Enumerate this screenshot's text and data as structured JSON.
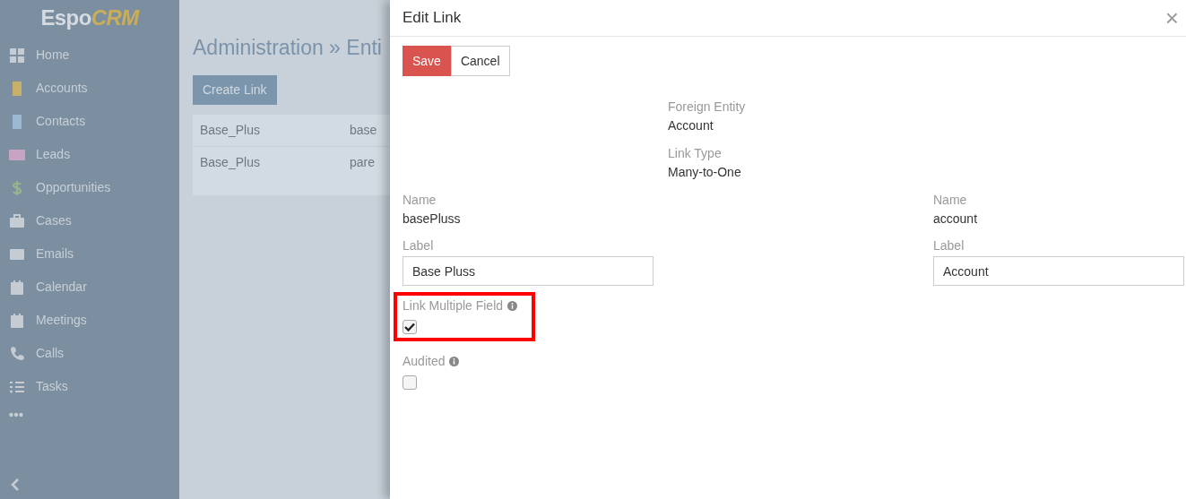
{
  "logo": {
    "part_1": "Espo",
    "part_2": "CRM"
  },
  "sidebar": {
    "items": [
      {
        "label": "Home"
      },
      {
        "label": "Accounts"
      },
      {
        "label": "Contacts"
      },
      {
        "label": "Leads"
      },
      {
        "label": "Opportunities"
      },
      {
        "label": "Cases"
      },
      {
        "label": "Emails"
      },
      {
        "label": "Calendar"
      },
      {
        "label": "Meetings"
      },
      {
        "label": "Calls"
      },
      {
        "label": "Tasks"
      }
    ]
  },
  "page": {
    "title": "Administration » Enti",
    "button": "Create Link",
    "rows": [
      [
        "Base_Plus",
        "base"
      ],
      [
        "Base_Plus",
        "pare"
      ]
    ]
  },
  "modal": {
    "title": "Edit Link",
    "close": "×",
    "buttons": [
      {
        "label": "Save",
        "kind": "primary"
      },
      {
        "label": "Cancel",
        "kind": "default"
      }
    ],
    "middle": [
      {
        "label": "Foreign Entity",
        "value": "Account"
      },
      {
        "label": "Link Type",
        "value": "Many-to-One"
      }
    ],
    "left": {
      "name_label": "Name",
      "name": "basePluss",
      "label_label": "Label",
      "label_value": "Base Pluss"
    },
    "right": {
      "name_label": "Name",
      "name": "account",
      "label_label": "Label",
      "label_value": "Account"
    },
    "checkboxes": [
      {
        "label": "Link Multiple Field",
        "checked": true,
        "highlighted": true
      },
      {
        "label": "Audited",
        "checked": false,
        "highlighted": false
      }
    ]
  }
}
